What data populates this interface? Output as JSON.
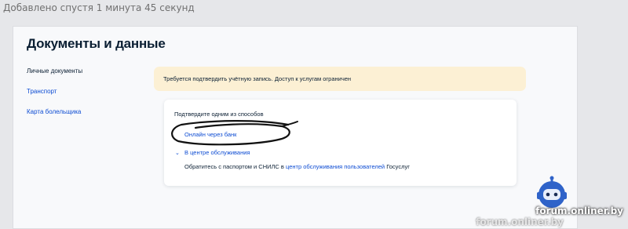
{
  "forum": {
    "caption": "Добавлено спустя 1 минута 45 секунд",
    "watermark": "forum.onliner.by"
  },
  "page": {
    "title": "Документы и данные"
  },
  "sidebar": {
    "items": [
      {
        "label": "Личные документы",
        "active": true
      },
      {
        "label": "Транспорт",
        "active": false
      },
      {
        "label": "Карта болельщика",
        "active": false
      }
    ]
  },
  "banner": {
    "text": "Требуется подтвердить учётную запись. Доступ к услугам ограничен"
  },
  "verify": {
    "heading": "Подтвердите одним из способов",
    "bank_link": "Онлайн через банк",
    "center_toggle": "В центре обслуживания",
    "center_desc_before": "Обратитесь с паспортом и СНИЛС в ",
    "center_desc_link": "центр обслуживания пользователей",
    "center_desc_after": " Госуслуг"
  },
  "colors": {
    "link": "#0d4cd3",
    "text": "#0b1f33",
    "banner_bg": "#fcf0d4",
    "page_bg": "#f8f9fb"
  },
  "icons": {
    "toggle": "chevron-down-icon",
    "mascot": "onliner-robot-mascot-icon"
  }
}
